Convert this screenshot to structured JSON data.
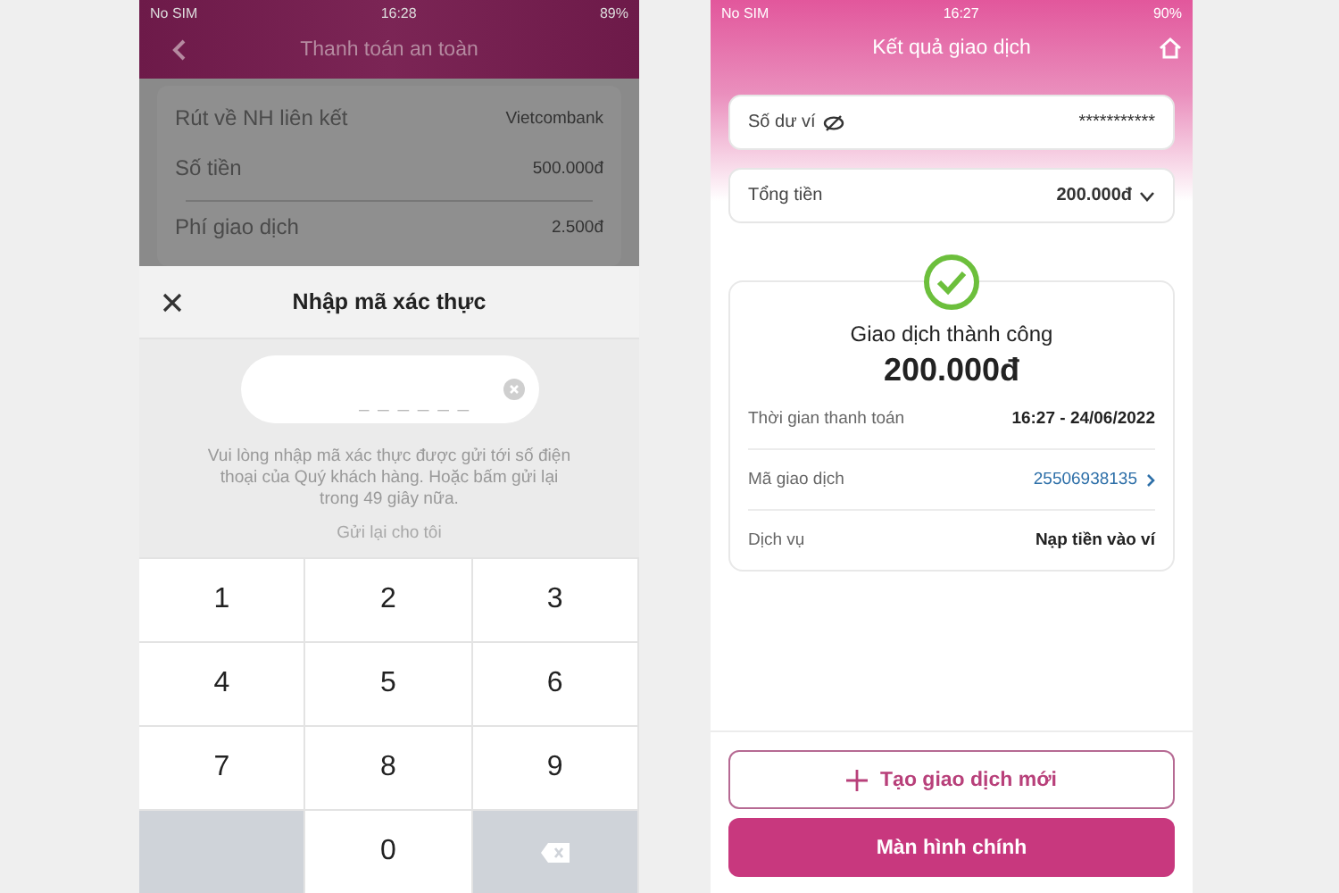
{
  "left_screen": {
    "status_bar": {
      "carrier": "No SIM",
      "time": "16:28",
      "battery": "89%"
    },
    "header": {
      "title": "Thanh toán an toàn"
    },
    "summary": [
      {
        "label": "Rút về NH liên kết",
        "value": "Vietcombank"
      },
      {
        "label": "Số tiền",
        "value": "500.000đ"
      },
      {
        "label": "Phí giao dịch",
        "value": "2.500đ"
      }
    ],
    "otp_sheet": {
      "title": "Nhập mã xác thực",
      "code_field": {
        "placeholder": "_ _ _ _ _ _"
      },
      "hint": "Vui lòng nhập mã xác thực được gửi tới số điện thoại của Quý khách hàng. Hoặc bấm gửi lại trong 49 giây nữa.",
      "resend": {
        "label": "Gửi lại cho tôi",
        "disabled": true
      }
    },
    "keypad": [
      {
        "kind": "digit",
        "label": "1"
      },
      {
        "kind": "digit",
        "label": "2"
      },
      {
        "kind": "digit",
        "label": "3"
      },
      {
        "kind": "digit",
        "label": "4"
      },
      {
        "kind": "digit",
        "label": "5"
      },
      {
        "kind": "digit",
        "label": "6"
      },
      {
        "kind": "digit",
        "label": "7"
      },
      {
        "kind": "digit",
        "label": "8"
      },
      {
        "kind": "digit",
        "label": "9"
      },
      {
        "kind": "blank"
      },
      {
        "kind": "digit",
        "label": "0"
      },
      {
        "kind": "delete"
      }
    ]
  },
  "right_screen": {
    "status_bar": {
      "carrier": "No SIM",
      "time": "16:27",
      "battery": "90%"
    },
    "header": {
      "title": "Kết quả giao dịch"
    },
    "balance": {
      "label": "Số dư ví",
      "value": "***********"
    },
    "total": {
      "label": "Tổng tiền",
      "value": "200.000đ",
      "expanded": false
    },
    "result": {
      "status": "Giao dịch thành công",
      "amount": "200.000đ",
      "details": [
        {
          "kind": "plain",
          "label": "Thời gian thanh toán",
          "value": "16:27 - 24/06/2022"
        },
        {
          "kind": "link",
          "label": "Mã giao dịch",
          "value": "25506938135"
        },
        {
          "kind": "plain",
          "label": "Dịch vụ",
          "value": "Nạp tiền vào ví"
        }
      ]
    },
    "buttons": [
      {
        "kind": "outline",
        "label": "Tạo giao dịch mới"
      },
      {
        "kind": "primary",
        "label": "Màn hình chính"
      }
    ]
  }
}
